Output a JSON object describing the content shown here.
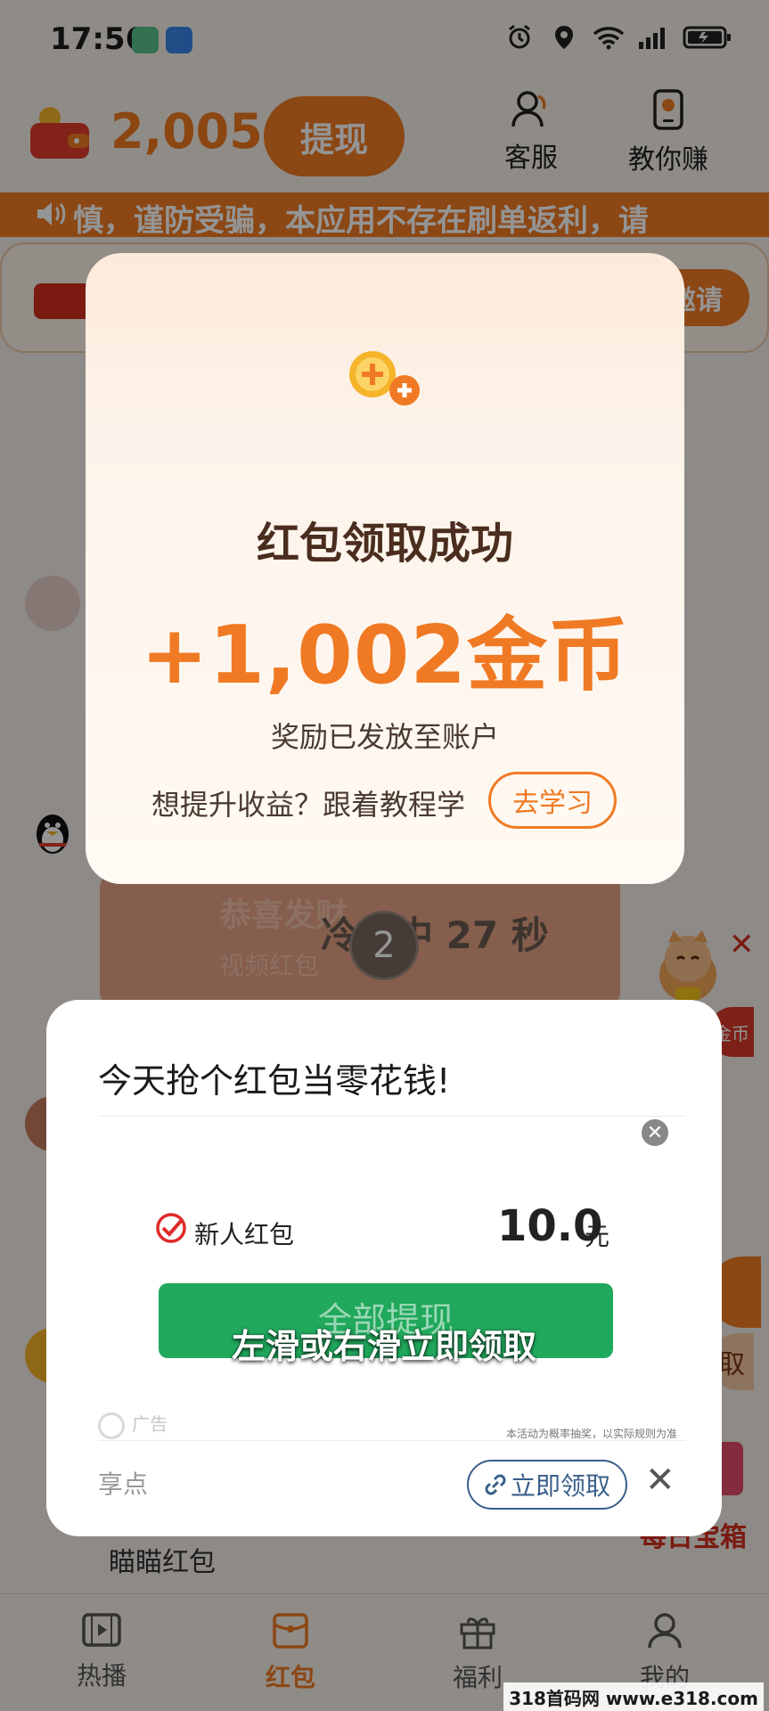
{
  "status_bar": {
    "time": "17:56"
  },
  "header": {
    "coin_count": "2,005",
    "withdraw_label": "提现",
    "service_label": "客服",
    "earn_guide_label": "教你赚"
  },
  "notice": {
    "text": "慎，谨防受骗，本应用不存在刷单返利，请"
  },
  "invite": {
    "button_label": "邀请"
  },
  "background": {
    "card_title": "恭喜发财",
    "card_subtitle": "视频红包",
    "cooldown_text": "冷却中 27 秒",
    "round_number": "2",
    "gold_pill": "金币",
    "right_button_label": "取",
    "daily_box_label": "每日宝箱",
    "meow_label": "瞄瞄红包"
  },
  "success_modal": {
    "title": "红包领取成功",
    "amount": "+1,002金币",
    "subtitle": "奖励已发放至账户",
    "learn_prompt": "想提升收益？跟着教程学",
    "learn_button": "去学习"
  },
  "ad_modal": {
    "title": "今天抢个红包当零花钱!",
    "item_label": "新人红包",
    "item_amount": "10.0",
    "item_unit": "元",
    "button_label": "全部提现",
    "swipe_hint": "左滑或右滑立即领取",
    "ad_tag": "广告",
    "disclaimer": "本活动为概率抽奖，以实际规则为准",
    "brand": "享点",
    "claim_button": "立即领取"
  },
  "bottom_nav": {
    "items": [
      {
        "label": "热播"
      },
      {
        "label": "红包"
      },
      {
        "label": "福利"
      },
      {
        "label": "我的"
      }
    ]
  },
  "watermark": {
    "text": "318首码网 www.e318.com"
  },
  "colors": {
    "accent_orange": "#f07a24",
    "modal_title_brown": "#4a2d1f",
    "ad_green": "#20a85c",
    "claim_blue": "#3a5f8a"
  }
}
